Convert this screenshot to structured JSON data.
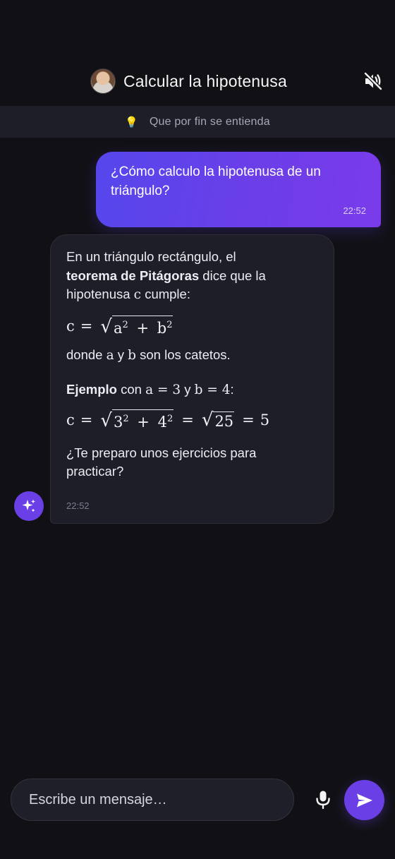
{
  "header": {
    "title": "Calcular la hipotenusa",
    "avatar_icon": "user-avatar-photo",
    "mute_icon": "speaker-muted-icon"
  },
  "subbar": {
    "icon": "lightbulb-icon",
    "text": "Que por fin se entienda"
  },
  "messages": [
    {
      "role": "user",
      "text": "¿Cómo calculo la hipotenusa de un triángulo?",
      "time": "22:52"
    },
    {
      "role": "assistant",
      "intro_pre": "En un triángulo rectángulo, el",
      "intro_bold": "teorema de Pitágoras",
      "intro_mid": "dice que la hipotenusa",
      "intro_var": "c",
      "intro_post": "cumple:",
      "formula": {
        "lhs": "c",
        "eq": "=",
        "a": "a",
        "b": "b",
        "exp": "2",
        "plus": "+"
      },
      "legs": {
        "pre": "donde",
        "a": "a",
        "and": "y",
        "b": "b",
        "post": "son los catetos."
      },
      "example": {
        "bold": "Ejemplo",
        "with": "con",
        "a_eq": "a = 3",
        "and": "y",
        "b_eq": "b = 4",
        "colon": ":"
      },
      "example_formula": {
        "lhs": "c",
        "eq": "=",
        "a": "3",
        "b": "4",
        "exp": "2",
        "plus": "+",
        "sum": "25",
        "result": "5"
      },
      "question": "¿Te preparo unos ejercicios para practicar?",
      "time": "22:52"
    }
  ],
  "ai_badge_icon": "sparkles-icon",
  "composer": {
    "placeholder": "Escribe un mensaje…",
    "mic_icon": "microphone-icon",
    "send_icon": "send-icon"
  },
  "colors": {
    "background": "#111115",
    "accent": "#6a40e6",
    "bubble_dark": "#1e1e29"
  }
}
